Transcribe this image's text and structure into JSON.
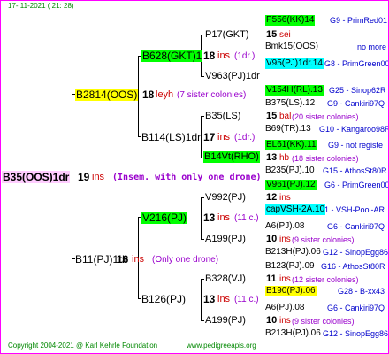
{
  "header": {
    "date": "17- 11-2021 ( 21: 28)"
  },
  "footer": {
    "copyright": "Copyright 2004-2021 @ Karl Kehrle Foundation",
    "site": "www.pedigreeapis.org"
  },
  "colors": {
    "frame": "#ff00ff",
    "green": "#00ff00",
    "yellow": "#ffff00",
    "cyan": "#00ffff",
    "pink": "#ffccff",
    "red": "#cc0000",
    "blue": "#0000cc"
  },
  "gen0": {
    "name": "B35(OOS)1dr",
    "num": "19",
    "ins": "ins",
    "note": "(Insem. with only one drone)"
  },
  "gen1": [
    {
      "name": "B2814(OOS)",
      "num": "18",
      "ins": "leyh",
      "note": "(7 sister colonies)"
    },
    {
      "name": "B11(PJ)1dr",
      "num": "16",
      "ins": "ins",
      "note": "(Only one drone)"
    }
  ],
  "gen2": [
    {
      "name": "B628(GKT)1",
      "num": "18",
      "ins": "ins",
      "note": "(1dr.)"
    },
    {
      "name": "B114(LS)1dr",
      "num": "17",
      "ins": "ins",
      "note": "(1dr.)"
    },
    {
      "name": "V216(PJ)",
      "num": "13",
      "ins": "ins",
      "note": "(11 c.)"
    },
    {
      "name": "B126(PJ)",
      "num": "13",
      "ins": "ins",
      "note": "(11 c.)"
    }
  ],
  "gen3": [
    {
      "name": "P17(GKT)",
      "num": "15",
      "ins": "sei",
      "note": ""
    },
    {
      "name": "V963(PJ)1dr",
      "num": "",
      "ins": "",
      "note": ""
    },
    {
      "name": "B35(LS)",
      "num": "15",
      "ins": "bal",
      "note": "(20 sister colonies)"
    },
    {
      "name": "B14Vt(RHO)",
      "num": "13",
      "ins": "hb",
      "note": "(18 sister colonies)"
    },
    {
      "name": "V992(PJ)",
      "num": "12",
      "ins": "ins",
      "note": ""
    },
    {
      "name": "A199(PJ)",
      "num": "10",
      "ins": "ins",
      "note": "(9 sister colonies)"
    },
    {
      "name": "B328(VJ)",
      "num": "11",
      "ins": "ins",
      "note": "(12 sister colonies)"
    },
    {
      "name": "A199(PJ)",
      "num": "10",
      "ins": "ins",
      "note": "(9 sister colonies)"
    }
  ],
  "gen4": [
    {
      "name": "P556(KK)14",
      "info": "G9 - PrimRed01"
    },
    {
      "name": "Bmk15(OOS)",
      "info": "no more"
    },
    {
      "name": "V95(PJ)1dr.14",
      "info": "G8 - PrimGreen00"
    },
    {
      "name": "V154H(RL).13",
      "info": "G25 - Sinop62R"
    },
    {
      "name": "B375(LS).12",
      "info": "G9 - Cankiri97Q"
    },
    {
      "name": "B69(TR).13",
      "info": "G10 - Kangaroo98R"
    },
    {
      "name": "EL61(KK).11",
      "info": "G9 - not registe"
    },
    {
      "name": "B235(PJ).10",
      "info": "G15 - AthosSt80R"
    },
    {
      "name": "V961(PJ).12",
      "info": "G6 - PrimGreen00"
    },
    {
      "name": "capVSH-2A.10",
      "info": "1 - VSH-Pool-AR"
    },
    {
      "name": "A6(PJ).08",
      "info": "G6 - Cankiri97Q"
    },
    {
      "name": "B213H(PJ).06",
      "info": "G12 - SinopEgg86R"
    },
    {
      "name": "B123(PJ).09",
      "info": "G16 - AthosSt80R"
    },
    {
      "name": "B190(PJ).06",
      "info": "G28 - B-xx43"
    },
    {
      "name": "A6(PJ).08",
      "info": "G6 - Cankiri97Q"
    },
    {
      "name": "B213H(PJ).06",
      "info": "G12 - SinopEgg86R"
    }
  ]
}
